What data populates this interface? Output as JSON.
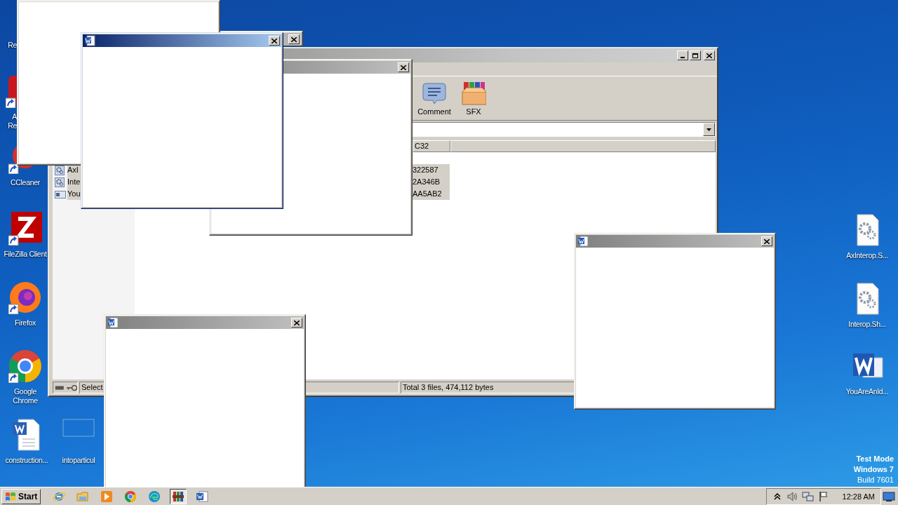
{
  "desktop_icons": [
    {
      "kind": "none",
      "label": "Re"
    },
    {
      "kind": "red-app",
      "label": "A Re",
      "shortcut": true
    },
    {
      "kind": "ccleaner",
      "label": "CCleaner",
      "shortcut": true
    },
    {
      "kind": "filezilla",
      "label": "FileZilla Client",
      "shortcut": true
    },
    {
      "kind": "firefox",
      "label": "Firefox",
      "shortcut": true
    },
    {
      "kind": "chrome",
      "label": "Google Chrome",
      "shortcut": true
    },
    {
      "kind": "word-doc",
      "label": "construction...",
      "shortcut": false
    },
    {
      "kind": "blank",
      "label": "intoparticul",
      "shortcut": false
    },
    {
      "kind": "gear-doc",
      "label": "AxInterop.S...",
      "shortcut": false
    },
    {
      "kind": "gear-doc",
      "label": "Interop.Sh...",
      "shortcut": false
    },
    {
      "kind": "word",
      "label": "YouAreAnId...",
      "shortcut": false
    }
  ],
  "archiver": {
    "active": false,
    "toolbar": [
      {
        "kind": "comment",
        "label": "Comment"
      },
      {
        "kind": "sfx",
        "label": "SFX"
      }
    ],
    "column_header": "C32",
    "files": [
      {
        "kind": "gear",
        "name": "AxI",
        "column_2": "322587",
        "selected": true
      },
      {
        "kind": "gear",
        "name": "Inte",
        "column_2": "2A346B",
        "selected": true
      },
      {
        "kind": "exe",
        "name": "You",
        "column_2": "AA5AB2",
        "selected": true
      }
    ],
    "status_left": "Select",
    "status_total": "Total 3 files, 474,112 bytes"
  },
  "popups": [
    {
      "active": false
    },
    {
      "active": false
    },
    {
      "active": false
    },
    {
      "icon": true,
      "active": true
    },
    {
      "icon": true,
      "active": false
    },
    {
      "icon": true,
      "active": false
    }
  ],
  "taskbar": {
    "start": "Start",
    "apps": [
      {
        "kind": "ie",
        "selected": false
      },
      {
        "kind": "explorer",
        "selected": false
      },
      {
        "kind": "media",
        "selected": false
      },
      {
        "kind": "chrome",
        "selected": false
      },
      {
        "kind": "edge",
        "selected": false
      },
      {
        "kind": "winrar",
        "selected": true
      },
      {
        "kind": "word",
        "selected": false
      }
    ],
    "clock": "12:28 AM"
  },
  "os_notice": [
    "Test Mode",
    "Windows 7",
    "Build 7601"
  ]
}
